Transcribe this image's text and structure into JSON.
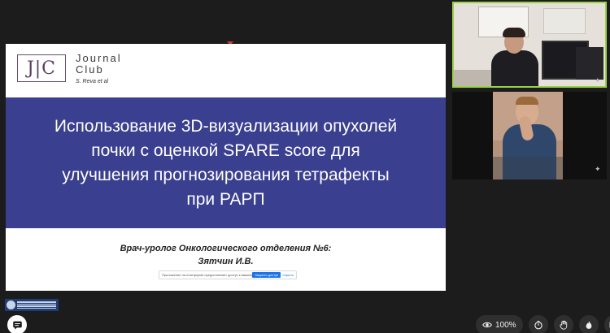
{
  "slide": {
    "logo_text": "J|C",
    "brand_line1": "Journal",
    "brand_line2": "Club",
    "brand_author": "S. Reva et al",
    "title": "Использование 3D-визуализации опухолей почки с оценкой SPARE score для улучшения прогнозирования тетрафекты при РАРП",
    "footer_line1": "Врач-уролог Онкологического отделения №6:",
    "footer_line2": "Зятчин И.В.",
    "band_color": "#3a3f8f"
  },
  "share_bar": {
    "text": "Приложение на платформе предоставляет доступ к вашему экрану.",
    "stop_label": "Закрыть доступ",
    "hide_label": "Скрыть"
  },
  "toolbar": {
    "zoom_value": "100%"
  },
  "colors": {
    "active_speaker": "#9bd14a",
    "background": "#1c1c1c"
  },
  "icons": {
    "chat": "chat-icon",
    "eye": "eye-icon",
    "timer": "timer-icon",
    "hand": "raise-hand-icon",
    "fire": "reaction-icon",
    "layout": "layout-icon",
    "pin": "pin-icon"
  }
}
